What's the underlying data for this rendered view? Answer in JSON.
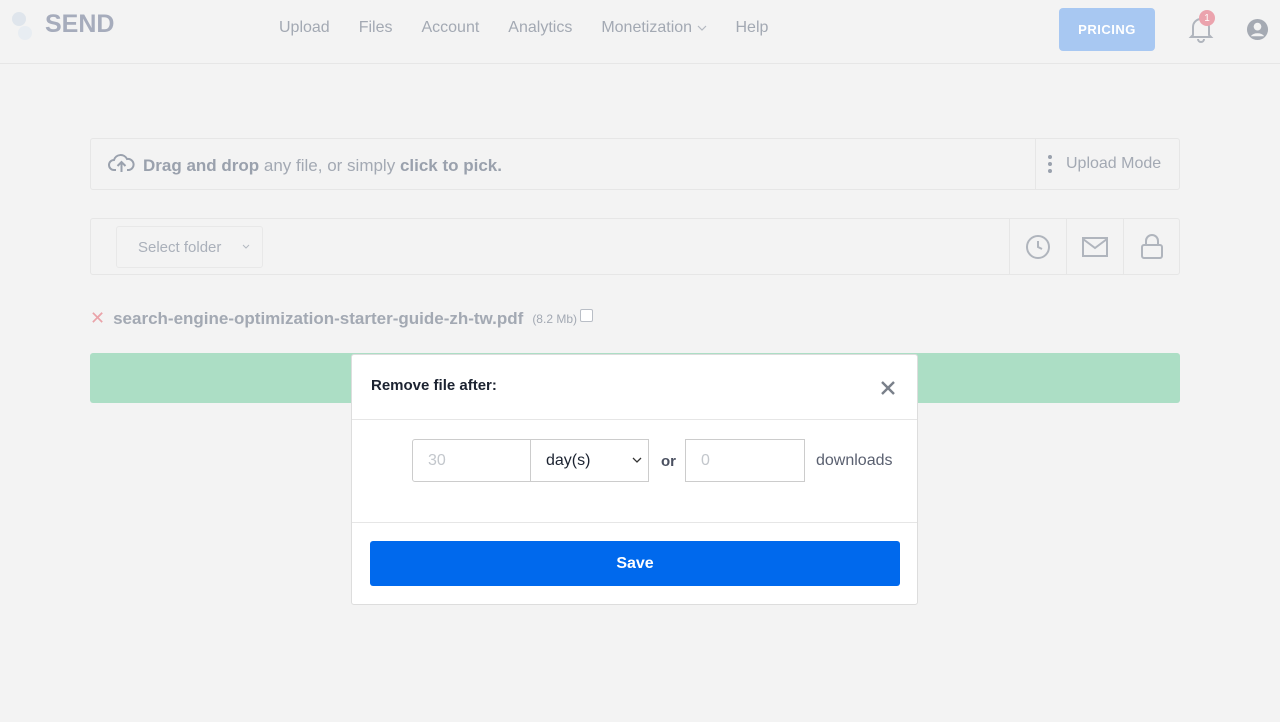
{
  "nav": {
    "brand": "SEND",
    "items": [
      {
        "label": "Upload"
      },
      {
        "label": "Files"
      },
      {
        "label": "Account"
      },
      {
        "label": "Analytics"
      },
      {
        "label": "Monetization"
      },
      {
        "label": "Help"
      }
    ],
    "pricing": "PRICING",
    "notification_count": "1"
  },
  "upload": {
    "drag_bold": "Drag and drop",
    "mid": " any file, or simply ",
    "pick_bold": "click to pick.",
    "mode": "Upload Mode"
  },
  "options": {
    "folder": "Select folder"
  },
  "file": {
    "name": "search-engine-optimization-starter-guide-zh-tw.pdf",
    "size": "(8.2 Mb)",
    "checked": false
  },
  "modal": {
    "title": "Remove file after:",
    "duration_placeholder": "30",
    "unit": "day(s)",
    "or": "or",
    "downloads_placeholder": "0",
    "downloads_label": "downloads",
    "save": "Save"
  },
  "colors": {
    "primary": "#0069ed",
    "progress": "#acdec5",
    "pricing": "#a8c8f2"
  }
}
